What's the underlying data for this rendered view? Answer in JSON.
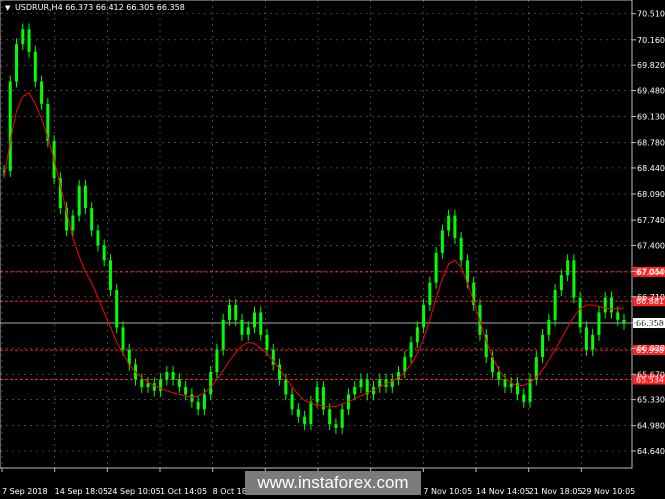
{
  "header": {
    "symbol_timeframe": "USDRUR,H4",
    "ohlc": "66.373 66.412 66.305 66.358"
  },
  "watermark": "www.instaforex.com",
  "colors": {
    "background": "#000000",
    "grid": "#c8c8c8",
    "candle": "#00ff00",
    "moving_average": "#ff0000",
    "level_line": "#ff2020",
    "price_line": "#aaaaaa",
    "text": "#ffffff"
  },
  "chart_data": {
    "type": "line",
    "subtype": "candlestick",
    "title": "",
    "xlabel": "",
    "ylabel": "",
    "ylim": [
      64.64,
      70.52
    ],
    "y_ticks": [
      "70.510",
      "70.160",
      "69.820",
      "69.480",
      "69.130",
      "68.780",
      "68.440",
      "68.090",
      "67.740",
      "67.400",
      "67.050",
      "66.710",
      "66.360",
      "66.020",
      "65.670",
      "65.330",
      "64.980",
      "64.640"
    ],
    "x_tick_labels": [
      "7 Sep 2018",
      "14 Sep 18:05",
      "24 Sep 10:05",
      "1 Oct 14:05",
      "8 Oct 18:05",
      "",
      "",
      "",
      "7 Nov 10:05",
      "14 Nov 14:05",
      "21 Nov 18:05",
      "29 Nov 10:05"
    ],
    "grid": true,
    "current_price": {
      "value": 66.358,
      "label": "66.358"
    },
    "levels": [
      {
        "value": 67.044,
        "label": "67.044"
      },
      {
        "value": 66.651,
        "label": "66.881"
      },
      {
        "value": 65.995,
        "label": "65.998"
      },
      {
        "value": 65.6,
        "label": "65.534"
      }
    ],
    "series": [
      {
        "name": "",
        "kind": "price",
        "values": [
          68.4,
          69.6,
          70.1,
          70.3,
          70.0,
          69.6,
          69.3,
          68.8,
          68.3,
          67.9,
          67.6,
          67.8,
          68.2,
          67.9,
          67.6,
          67.4,
          67.2,
          66.8,
          66.3,
          66.0,
          65.8,
          65.6,
          65.5,
          65.55,
          65.45,
          65.6,
          65.7,
          65.6,
          65.5,
          65.4,
          65.3,
          65.2,
          65.4,
          65.7,
          66.0,
          66.4,
          66.6,
          66.4,
          66.2,
          66.3,
          66.5,
          66.2,
          66.0,
          65.8,
          65.6,
          65.4,
          65.2,
          65.1,
          65.0,
          65.3,
          65.5,
          65.2,
          65.0,
          64.95,
          65.2,
          65.4,
          65.5,
          65.6,
          65.4,
          65.5,
          65.6,
          65.5,
          65.6,
          65.7,
          65.9,
          66.1,
          66.3,
          66.6,
          66.9,
          67.3,
          67.6,
          67.8,
          67.5,
          67.2,
          66.9,
          66.6,
          66.2,
          65.9,
          65.7,
          65.6,
          65.5,
          65.55,
          65.4,
          65.3,
          65.6,
          65.9,
          66.2,
          66.4,
          66.8,
          67.0,
          67.2,
          66.7,
          66.3,
          66.0,
          66.2,
          66.5,
          66.7,
          66.5,
          66.4,
          66.35
        ]
      },
      {
        "name": "",
        "kind": "moving_average",
        "values": [
          68.3,
          68.8,
          69.2,
          69.4,
          69.45,
          69.3,
          69.1,
          68.85,
          68.55,
          68.2,
          67.85,
          67.5,
          67.25,
          67.05,
          66.9,
          66.7,
          66.5,
          66.3,
          66.1,
          65.95,
          65.8,
          65.7,
          65.62,
          65.56,
          65.52,
          65.48,
          65.45,
          65.42,
          65.4,
          65.38,
          65.36,
          65.38,
          65.42,
          65.5,
          65.6,
          65.72,
          65.85,
          65.96,
          66.05,
          66.1,
          66.08,
          66.02,
          65.95,
          65.85,
          65.74,
          65.62,
          65.5,
          65.4,
          65.32,
          65.28,
          65.26,
          65.24,
          65.23,
          65.24,
          65.27,
          65.3,
          65.34,
          65.38,
          65.42,
          65.46,
          65.5,
          65.54,
          65.58,
          65.63,
          65.7,
          65.8,
          65.95,
          66.15,
          66.4,
          66.7,
          66.95,
          67.15,
          67.2,
          67.1,
          66.9,
          66.65,
          66.38,
          66.12,
          65.9,
          65.73,
          65.62,
          65.55,
          65.52,
          65.52,
          65.56,
          65.63,
          65.73,
          65.86,
          66.0,
          66.15,
          66.3,
          66.44,
          66.55,
          66.6,
          66.6,
          66.58,
          66.56,
          66.55,
          66.55,
          66.56
        ]
      }
    ]
  }
}
